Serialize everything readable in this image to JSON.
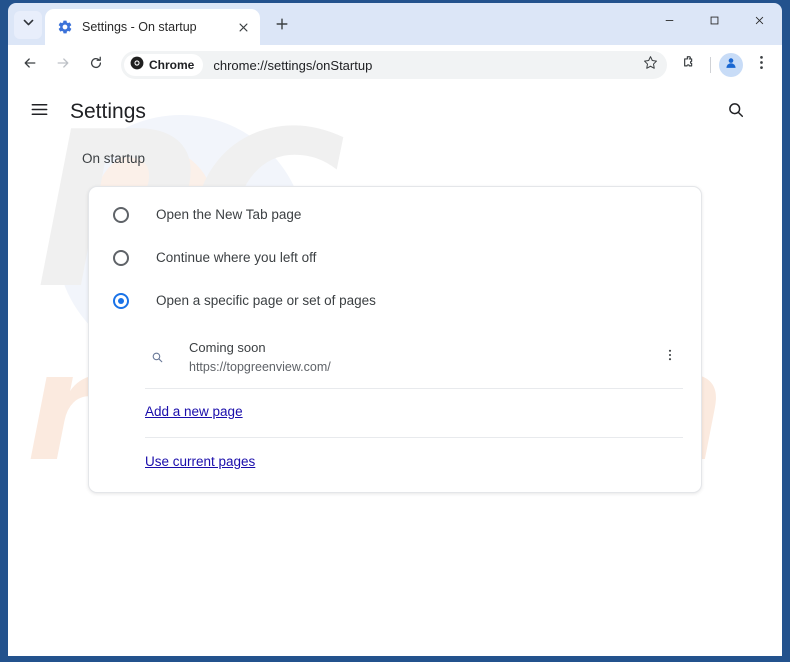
{
  "browser": {
    "tab_search_icon": "chevron-down-icon",
    "tab": {
      "favicon": "settings-gear-icon",
      "title": "Settings - On startup",
      "close_icon": "close-icon"
    },
    "new_tab_icon": "plus-icon",
    "window_controls": {
      "minimize_icon": "minimize-icon",
      "maximize_icon": "maximize-icon",
      "close_icon": "close-icon"
    },
    "toolbar": {
      "back_icon": "back-arrow-icon",
      "forward_icon": "forward-arrow-icon",
      "reload_icon": "reload-icon",
      "chrome_chip_label": "Chrome",
      "chrome_chip_icon": "chrome-logo-icon",
      "url": "chrome://settings/onStartup",
      "bookmark_icon": "star-icon",
      "extensions_icon": "puzzle-piece-icon",
      "profile_icon": "user-avatar-icon",
      "menu_icon": "three-dot-menu-icon"
    },
    "frame_color": "#23528d"
  },
  "settings": {
    "menu_icon": "hamburger-menu-icon",
    "title": "Settings",
    "search_icon": "search-icon",
    "section_heading": "On startup",
    "startup_options": [
      {
        "label": "Open the New Tab page",
        "checked": false
      },
      {
        "label": "Continue where you left off",
        "checked": false
      },
      {
        "label": "Open a specific page or set of pages",
        "checked": true
      }
    ],
    "startup_page": {
      "icon": "search-icon",
      "title": "Coming soon",
      "url": "https://topgreenview.com/",
      "menu_icon": "three-dot-menu-icon"
    },
    "add_page_link": "Add a new page",
    "use_current_pages_link": "Use current pages",
    "accent_color": "#1a73e8",
    "link_color": "#1a0dab"
  },
  "watermark": {
    "primary": "PC",
    "secondary": "risk.com"
  }
}
